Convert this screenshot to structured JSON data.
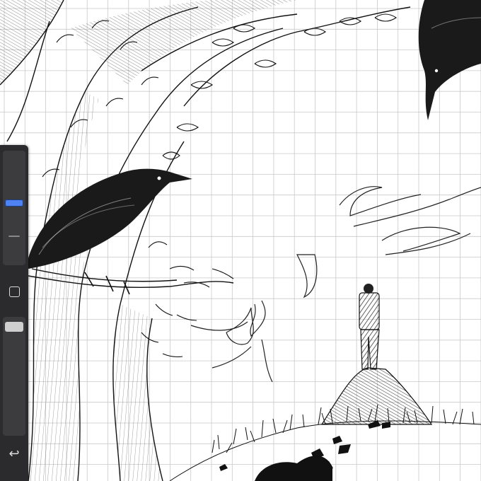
{
  "canvas": {
    "background_color": "#ffffff",
    "grid_color": "#c9c9c9",
    "ink_color": "#111111",
    "grid_visible": true
  },
  "sidebar": {
    "background_color": "#2b2b2d",
    "brush_size": {
      "value_fraction": 0.55,
      "accent_color": "#4f82f2"
    },
    "modify_button": {
      "icon": "square-icon"
    },
    "opacity": {
      "value_fraction": 0.97
    },
    "undo_button": {
      "icon": "undo-arrow-icon",
      "glyph": "↩"
    }
  }
}
